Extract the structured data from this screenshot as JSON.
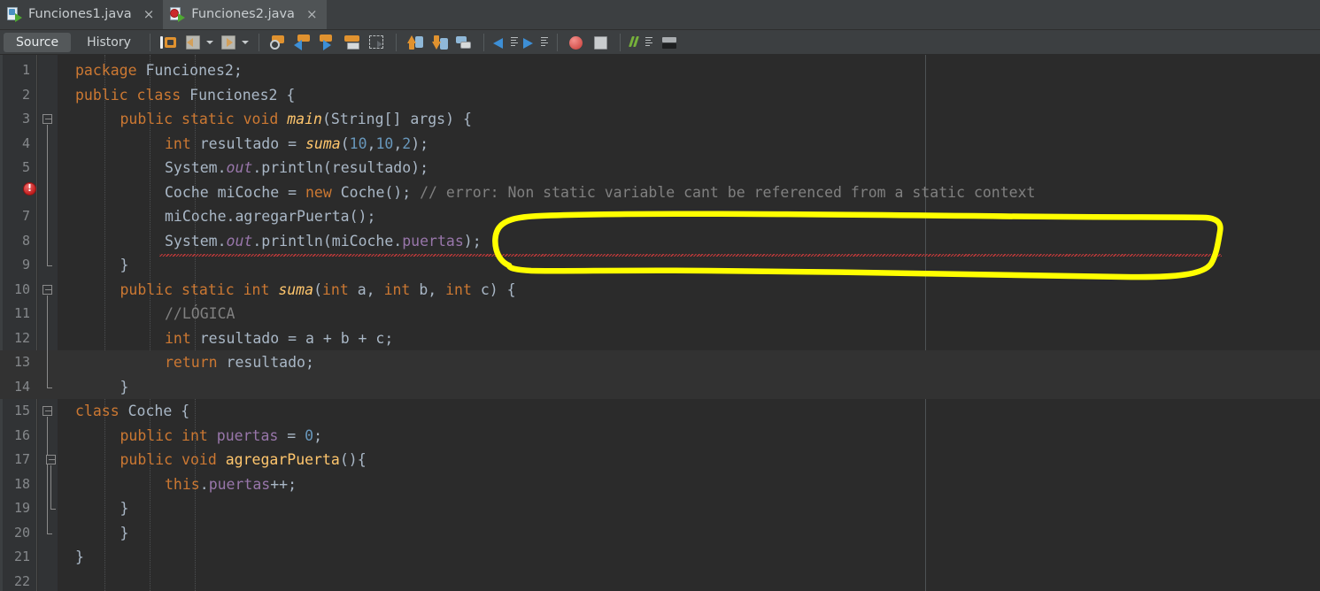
{
  "window": {
    "tabs": [
      {
        "label": "Funciones1.java",
        "icon": "java-file-icon",
        "close": "×",
        "active": false
      },
      {
        "label": "Funciones2.java",
        "icon": "java-file-error-icon",
        "close": "×",
        "active": true
      }
    ]
  },
  "view_tabs": [
    {
      "label": "Source",
      "selected": true
    },
    {
      "label": "History",
      "selected": false
    }
  ],
  "toolbar": {
    "buttons": [
      "toggle-rectangular-selection-icon",
      "last-edit-back-icon",
      "last-edit-forward-icon",
      "find-selection-icon",
      "previous-occurrence-icon",
      "next-occurrence-icon",
      "toggle-highlight-icon",
      "toggle-rectangular-block-icon",
      "shift-line-up-icon",
      "shift-line-down-icon",
      "next-bookmark-icon",
      "previous-bookmark-icon",
      "forward-bookmark-icon",
      "toggle-breakpoint-icon",
      "stop-icon",
      "comment-icon",
      "inspect-icon"
    ]
  },
  "colors": {
    "editor_background": "#2b2b2b",
    "gutter_background": "#313335",
    "toolbar_background": "#3c3f41",
    "keyword": "#cc7832",
    "number": "#6897bb",
    "method": "#ffc66d",
    "field": "#9876aa",
    "comment": "#808080",
    "default_text": "#a9b7c6",
    "error_underline": "#cc3b3b",
    "annotation_highlight": "#ffff00"
  },
  "editor": {
    "margin_column_x": 1045,
    "highlighted_lines": [
      13,
      14
    ],
    "error_line": 6,
    "lines": [
      {
        "n": 1,
        "indent": 0,
        "tokens": [
          {
            "t": "package ",
            "c": "kw"
          },
          {
            "t": "Funciones2;",
            "c": "plain"
          }
        ]
      },
      {
        "n": 2,
        "indent": 0,
        "tokens": [
          {
            "t": "public class ",
            "c": "kw"
          },
          {
            "t": "Funciones2 {",
            "c": "plain"
          }
        ]
      },
      {
        "n": 3,
        "indent": 1,
        "tokens": [
          {
            "t": "public static void ",
            "c": "kw"
          },
          {
            "t": "main",
            "c": "fn"
          },
          {
            "t": "(String[] args) {",
            "c": "plain"
          }
        ]
      },
      {
        "n": 4,
        "indent": 2,
        "tokens": [
          {
            "t": "int ",
            "c": "kw"
          },
          {
            "t": "resultado = ",
            "c": "plain"
          },
          {
            "t": "suma",
            "c": "fn"
          },
          {
            "t": "(",
            "c": "plain"
          },
          {
            "t": "10",
            "c": "num"
          },
          {
            "t": ",",
            "c": "plain"
          },
          {
            "t": "10",
            "c": "num"
          },
          {
            "t": ",",
            "c": "plain"
          },
          {
            "t": "2",
            "c": "num"
          },
          {
            "t": ");",
            "c": "plain"
          }
        ]
      },
      {
        "n": 5,
        "indent": 2,
        "tokens": [
          {
            "t": "System.",
            "c": "plain"
          },
          {
            "t": "out",
            "c": "fld"
          },
          {
            "t": ".println(resultado);",
            "c": "plain"
          }
        ]
      },
      {
        "n": 6,
        "indent": 2,
        "tokens": [
          {
            "t": "Coche",
            "c": "plain"
          },
          {
            "t": " miCoche = ",
            "c": "plain"
          },
          {
            "t": "new ",
            "c": "kw"
          },
          {
            "t": "Coche(); ",
            "c": "plain"
          },
          {
            "t": "// error: Non static variable cant be referenced from a static context",
            "c": "cmt"
          }
        ]
      },
      {
        "n": 7,
        "indent": 2,
        "tokens": [
          {
            "t": "miCoche.agregarPuerta();",
            "c": "plain"
          }
        ]
      },
      {
        "n": 8,
        "indent": 2,
        "tokens": [
          {
            "t": "System.",
            "c": "plain"
          },
          {
            "t": "out",
            "c": "fld"
          },
          {
            "t": ".println(miCoche.",
            "c": "plain"
          },
          {
            "t": "puertas",
            "c": "fldn"
          },
          {
            "t": ");",
            "c": "plain"
          }
        ]
      },
      {
        "n": 9,
        "indent": 1,
        "tokens": [
          {
            "t": "}",
            "c": "plain"
          }
        ]
      },
      {
        "n": 10,
        "indent": 1,
        "tokens": [
          {
            "t": "public static int ",
            "c": "kw"
          },
          {
            "t": "suma",
            "c": "fn"
          },
          {
            "t": "(",
            "c": "plain"
          },
          {
            "t": "int ",
            "c": "kw"
          },
          {
            "t": "a, ",
            "c": "plain"
          },
          {
            "t": "int ",
            "c": "kw"
          },
          {
            "t": "b, ",
            "c": "plain"
          },
          {
            "t": "int ",
            "c": "kw"
          },
          {
            "t": "c) {",
            "c": "plain"
          }
        ]
      },
      {
        "n": 11,
        "indent": 2,
        "tokens": [
          {
            "t": "//LÓGICA",
            "c": "cmt"
          }
        ]
      },
      {
        "n": 12,
        "indent": 2,
        "tokens": [
          {
            "t": "int ",
            "c": "kw"
          },
          {
            "t": "resultado = a + b + c;",
            "c": "plain"
          }
        ]
      },
      {
        "n": 13,
        "indent": 2,
        "tokens": [
          {
            "t": "return ",
            "c": "kw"
          },
          {
            "t": "resultado;",
            "c": "plain"
          }
        ]
      },
      {
        "n": 14,
        "indent": 1,
        "tokens": [
          {
            "t": "}",
            "c": "plain"
          }
        ]
      },
      {
        "n": 15,
        "indent": 0,
        "tokens": [
          {
            "t": "class ",
            "c": "kw"
          },
          {
            "t": "Coche {",
            "c": "plain"
          }
        ]
      },
      {
        "n": 16,
        "indent": 1,
        "tokens": [
          {
            "t": "public int ",
            "c": "kw"
          },
          {
            "t": "puertas",
            "c": "fldn"
          },
          {
            "t": " = ",
            "c": "plain"
          },
          {
            "t": "0",
            "c": "num"
          },
          {
            "t": ";",
            "c": "plain"
          }
        ]
      },
      {
        "n": 17,
        "indent": 1,
        "tokens": [
          {
            "t": "public void ",
            "c": "kw"
          },
          {
            "t": "agregarPuerta",
            "c": "fnb"
          },
          {
            "t": "(){",
            "c": "plain"
          }
        ]
      },
      {
        "n": 18,
        "indent": 2,
        "tokens": [
          {
            "t": "this",
            "c": "kw"
          },
          {
            "t": ".",
            "c": "plain"
          },
          {
            "t": "puertas",
            "c": "fldn"
          },
          {
            "t": "++;",
            "c": "plain"
          }
        ]
      },
      {
        "n": 19,
        "indent": 1,
        "tokens": [
          {
            "t": "}",
            "c": "plain"
          }
        ]
      },
      {
        "n": 20,
        "indent": 1,
        "tokens": [
          {
            "t": "}",
            "c": "plain"
          }
        ]
      },
      {
        "n": 21,
        "indent": 0,
        "tokens": [
          {
            "t": "}",
            "c": "plain"
          }
        ]
      },
      {
        "n": 22,
        "indent": 0,
        "tokens": []
      }
    ]
  },
  "annotation": {
    "type": "freehand-yellow-circle",
    "encircled_text": "error: Non static variable cant be referenced from a static context",
    "color": "#ffff00"
  }
}
